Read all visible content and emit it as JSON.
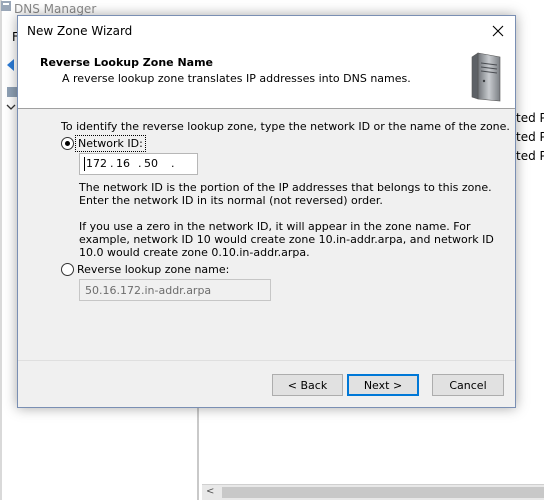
{
  "background_app": {
    "title": "DNS Manager",
    "menu_letter": "F",
    "right_column_texts": [
      "ted Pr",
      "ted Pr",
      "ted Pr"
    ]
  },
  "dialog": {
    "title": "New Zone Wizard",
    "header": {
      "title": "Reverse Lookup Zone Name",
      "subtitle": "A reverse lookup zone translates IP addresses into DNS names."
    },
    "intro": "To identify the reverse lookup zone, type the network ID or the name of the zone.",
    "network_id": {
      "label": "Network ID:",
      "selected": true,
      "octets": [
        "172",
        "16",
        "50",
        ""
      ]
    },
    "network_id_help": "The network ID is the portion of the IP addresses that belongs to this zone. Enter the network ID in its normal (not reversed) order.",
    "zero_help": "If you use a zero in the network ID, it will appear in the zone name. For example, network ID 10 would create zone 10.in-addr.arpa, and network ID 10.0 would create zone 0.10.in-addr.arpa.",
    "zone_name": {
      "label": "Reverse lookup zone name:",
      "selected": false,
      "value": "50.16.172.in-addr.arpa"
    },
    "buttons": {
      "back": "< Back",
      "next": "Next >",
      "cancel": "Cancel"
    }
  }
}
